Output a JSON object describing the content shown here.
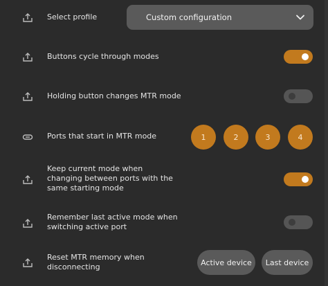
{
  "settings": {
    "profile": {
      "label": "Select profile",
      "selected": "Custom configuration"
    },
    "cycle_modes": {
      "label": "Buttons cycle through modes",
      "enabled": true
    },
    "hold_changes_mode": {
      "label": "Holding button changes MTR mode",
      "enabled": false
    },
    "ports_mtr": {
      "label": "Ports that start in MTR mode",
      "ports": [
        "1",
        "2",
        "3",
        "4"
      ]
    },
    "keep_mode": {
      "label": "Keep current mode when changing between ports with the same starting mode",
      "enabled": true
    },
    "remember_mode": {
      "label": "Remember last active mode when switching active port",
      "enabled": false
    },
    "reset_memory": {
      "label": "Reset MTR memory when disconnecting",
      "options": [
        "Active device",
        "Last device"
      ]
    }
  },
  "icons": {
    "share": "share-icon",
    "link": "link-icon",
    "chevron": "chevron-down-icon"
  },
  "colors": {
    "accent": "#c27a1e",
    "background": "#2b2b2b",
    "control_bg": "#5a5a5a",
    "toggle_off": "#555555"
  }
}
